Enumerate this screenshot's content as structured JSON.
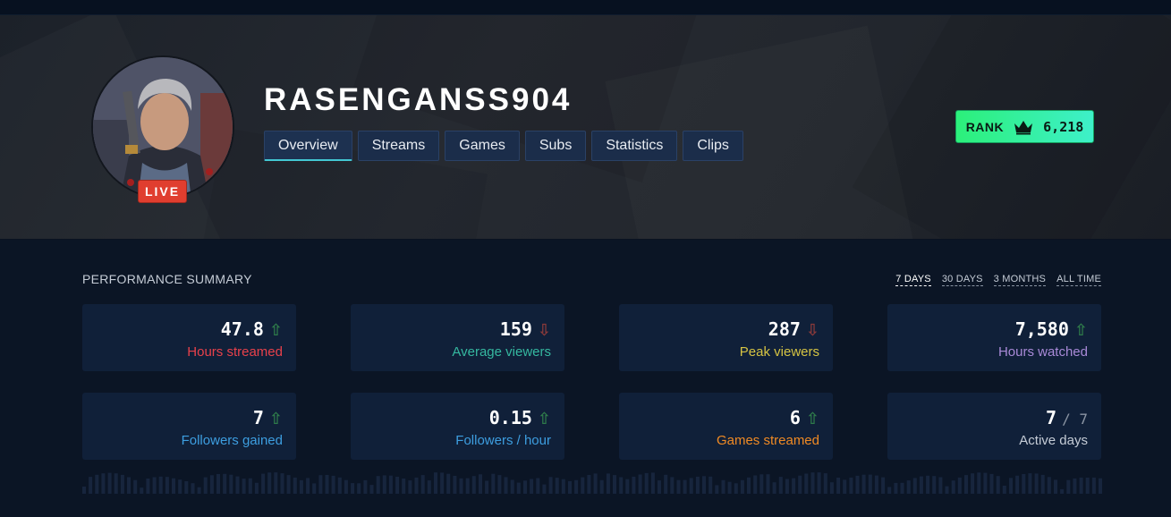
{
  "channel": {
    "name": "RASENGANSS904",
    "live_label": "LIVE"
  },
  "tabs": [
    {
      "label": "Overview",
      "active": true
    },
    {
      "label": "Streams",
      "active": false
    },
    {
      "label": "Games",
      "active": false
    },
    {
      "label": "Subs",
      "active": false
    },
    {
      "label": "Statistics",
      "active": false
    },
    {
      "label": "Clips",
      "active": false
    }
  ],
  "rank": {
    "label": "RANK",
    "icon": "crown-icon",
    "value": "6,218"
  },
  "summary": {
    "title": "PERFORMANCE SUMMARY",
    "ranges": [
      {
        "label": "7 DAYS",
        "active": true
      },
      {
        "label": "30 DAYS",
        "active": false
      },
      {
        "label": "3 MONTHS",
        "active": false
      },
      {
        "label": "ALL TIME",
        "active": false
      }
    ]
  },
  "stats": [
    {
      "value": "47.8",
      "trend": "up",
      "label": "Hours streamed",
      "color": "#e8414b"
    },
    {
      "value": "159",
      "trend": "down",
      "label": "Average viewers",
      "color": "#35b8a0"
    },
    {
      "value": "287",
      "trend": "down",
      "label": "Peak viewers",
      "color": "#d6c443"
    },
    {
      "value": "7,580",
      "trend": "up",
      "label": "Hours watched",
      "color": "#a98ad8"
    },
    {
      "value": "7",
      "trend": "up",
      "label": "Followers gained",
      "color": "#3d9ee0"
    },
    {
      "value": "0.15",
      "trend": "up",
      "label": "Followers / hour",
      "color": "#3d9ee0"
    },
    {
      "value": "6",
      "trend": "up",
      "label": "Games streamed",
      "color": "#f08a24"
    },
    {
      "value": "7",
      "suffix": "/ 7",
      "trend": null,
      "label": "Active days",
      "color": "#c5ccd6"
    }
  ],
  "colors": {
    "background": "#0b1525",
    "card": "#102039",
    "tab": "#1b2d4a",
    "tab_active_underline": "#43c7d3",
    "live": "#e03e2f",
    "rank_gradient_start": "#2cf07a",
    "rank_gradient_end": "#3ef0c9"
  }
}
